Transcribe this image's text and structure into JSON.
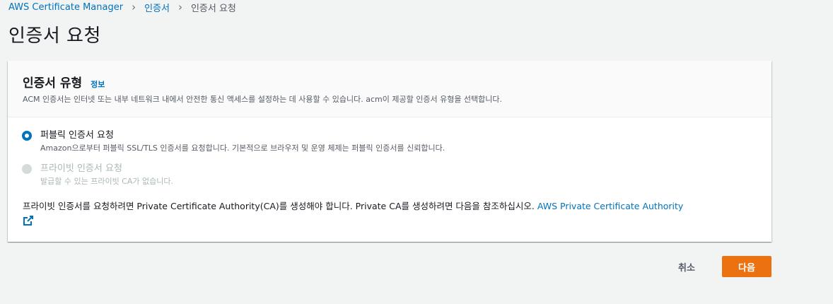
{
  "breadcrumb": {
    "items": [
      "AWS Certificate Manager",
      "인증서",
      "인증서 요청"
    ]
  },
  "page": {
    "title": "인증서 요청"
  },
  "card": {
    "title": "인증서 유형",
    "info_link": "정보",
    "description": "ACM 인증서는 인터넷 또는 내부 네트워크 내에서 안전한 통신 액세스를 설정하는 데 사용할 수 있습니다. acm이 제공할 인증서 유형을 선택합니다.",
    "options": [
      {
        "label": "퍼블릭 인증서 요청",
        "description": "Amazon으로부터 퍼블릭 SSL/TLS 인증서를 요청합니다. 기본적으로 브라우저 및 운영 체제는 퍼블릭 인증서를 신뢰합니다.",
        "selected": true,
        "disabled": false
      },
      {
        "label": "프라이빗 인증서 요청",
        "description": "발급할 수 있는 프라이빗 CA가 없습니다.",
        "selected": false,
        "disabled": true
      }
    ],
    "note_text": "프라이빗 인증서를 요청하려면 Private Certificate Authority(CA)를 생성해야 합니다. Private CA를 생성하려면 다음을 참조하십시오. ",
    "note_link": "AWS Private Certificate Authority",
    "note_link_icon": "external-link-icon"
  },
  "actions": {
    "cancel_label": "취소",
    "next_label": "다음"
  },
  "colors": {
    "link": "#0073bb",
    "primary_button": "#ec7211",
    "background": "#f2f3f3"
  }
}
